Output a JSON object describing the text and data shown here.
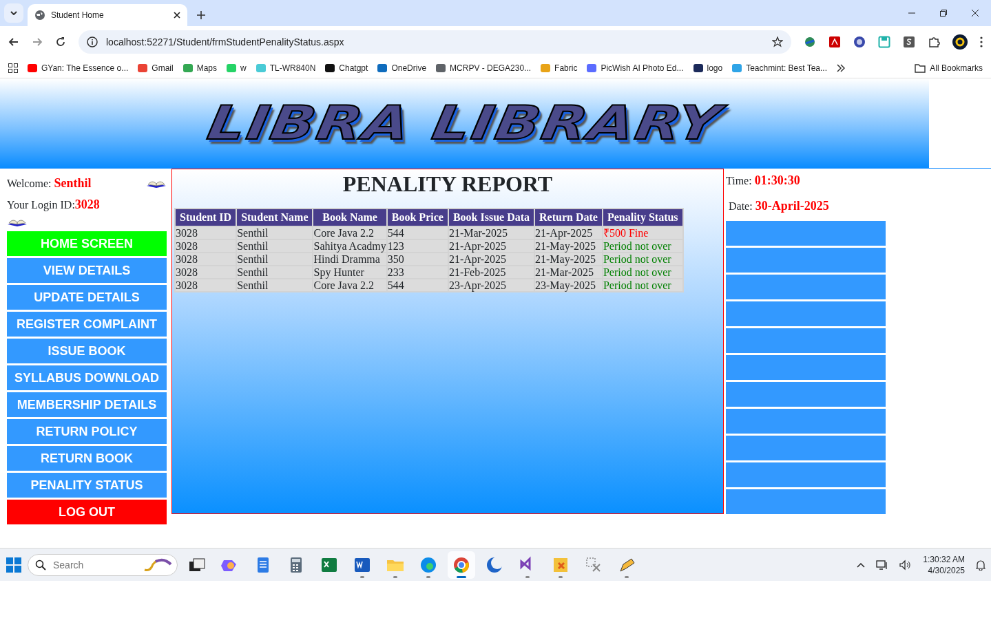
{
  "browser": {
    "tab_title": "Student Home",
    "url": "localhost:52271/Student/frmStudentPenalityStatus.aspx",
    "bookmarks": [
      {
        "label": "GYan: The Essence o...",
        "color": "#ff0000"
      },
      {
        "label": "Gmail",
        "color": "#ea4335"
      },
      {
        "label": "Maps",
        "color": "#34a853"
      },
      {
        "label": "w",
        "color": "#25d366"
      },
      {
        "label": "TL-WR840N",
        "color": "#4acbd6"
      },
      {
        "label": "Chatgpt",
        "color": "#111111"
      },
      {
        "label": "OneDrive",
        "color": "#0f6cbd"
      },
      {
        "label": "MCRPV - DEGA230...",
        "color": "#5f6368"
      },
      {
        "label": "Fabric",
        "color": "#e8a317"
      },
      {
        "label": "PicWish AI Photo Ed...",
        "color": "#5b6cff"
      },
      {
        "label": "logo",
        "color": "#1b2a5a"
      },
      {
        "label": "Teachmint: Best Tea...",
        "color": "#2fa4e7"
      }
    ],
    "all_bookmarks": "All Bookmarks"
  },
  "banner": {
    "logo_text": "LIBRA LIBRARY"
  },
  "user": {
    "welcome_label": "Welcome:",
    "name": "Senthil",
    "login_label": "Your Login ID:",
    "login_id": "3028"
  },
  "menu": [
    {
      "label": "HOME SCREEN",
      "color": "#00ff00"
    },
    {
      "label": "VIEW DETAILS",
      "color": "#3399ff"
    },
    {
      "label": "UPDATE DETAILS",
      "color": "#3399ff"
    },
    {
      "label": "REGISTER COMPLAINT",
      "color": "#3399ff"
    },
    {
      "label": "ISSUE BOOK",
      "color": "#3399ff"
    },
    {
      "label": "SYLLABUS DOWNLOAD",
      "color": "#3399ff"
    },
    {
      "label": "MEMBERSHIP DETAILS",
      "color": "#3399ff"
    },
    {
      "label": "RETURN POLICY",
      "color": "#3399ff"
    },
    {
      "label": "RETURN BOOK",
      "color": "#3399ff"
    },
    {
      "label": "PENALITY STATUS",
      "color": "#3399ff"
    },
    {
      "label": "LOG OUT",
      "color": "#ff0000"
    }
  ],
  "report": {
    "title": "PENALITY REPORT",
    "columns": [
      "Student ID",
      "Student Name",
      "Book Name",
      "Book Price",
      "Book Issue Data",
      "Return Date",
      "Penality Status"
    ],
    "rows": [
      {
        "cells": [
          "3028",
          "Senthil",
          "Core Java 2.2",
          "544",
          "21-Mar-2025",
          "21-Apr-2025",
          "₹500 Fine"
        ],
        "color": "#ff0000"
      },
      {
        "cells": [
          "3028",
          "Senthil",
          "Sahitya Acadmy",
          "123",
          "21-Apr-2025",
          "21-May-2025",
          "Period not over"
        ],
        "color": "#008000"
      },
      {
        "cells": [
          "3028",
          "Senthil",
          "Hindi Dramma",
          "350",
          "21-Apr-2025",
          "21-May-2025",
          "Period not over"
        ],
        "color": "#008000"
      },
      {
        "cells": [
          "3028",
          "Senthil",
          "Spy Hunter",
          "233",
          "21-Feb-2025",
          "21-Mar-2025",
          "Period not over"
        ],
        "color": "#008000"
      },
      {
        "cells": [
          "3028",
          "Senthil",
          "Core Java 2.2",
          "544",
          "23-Apr-2025",
          "23-May-2025",
          "Period not over"
        ],
        "color": "#008000"
      }
    ]
  },
  "clock": {
    "time_label": "Time:",
    "time": "01:30:30",
    "date_label": "Date:",
    "date": "30-April-2025"
  },
  "side_slots": [
    {
      "kind": "blank"
    },
    {
      "kind": "blank"
    },
    {
      "kind": "blank"
    },
    {
      "kind": "blank"
    },
    {
      "kind": "blank"
    },
    {
      "kind": "blank"
    },
    {
      "kind": "blank"
    },
    {
      "kind": "blank"
    },
    {
      "kind": "blank"
    },
    {
      "kind": "blank"
    },
    {
      "kind": "blank"
    }
  ],
  "taskbar": {
    "search_placeholder": "Search",
    "time": "1:30:32 AM",
    "date": "4/30/2025",
    "apps": [
      {
        "kind": "task-view",
        "running": false,
        "selected": false
      },
      {
        "kind": "copilot",
        "running": false,
        "selected": false
      },
      {
        "kind": "notepad",
        "running": false,
        "selected": false
      },
      {
        "kind": "calculator",
        "running": false,
        "selected": false
      },
      {
        "kind": "spreadsheet",
        "running": false,
        "selected": false
      },
      {
        "kind": "document",
        "running": true,
        "selected": false
      },
      {
        "kind": "folder",
        "running": true,
        "selected": false
      },
      {
        "kind": "edge",
        "running": true,
        "selected": false
      },
      {
        "kind": "chrome",
        "running": true,
        "selected": true
      },
      {
        "kind": "moon",
        "running": false,
        "selected": false
      },
      {
        "kind": "studio",
        "running": true,
        "selected": false
      },
      {
        "kind": "archive",
        "running": true,
        "selected": false
      },
      {
        "kind": "tools",
        "running": false,
        "selected": false
      },
      {
        "kind": "pencil",
        "running": true,
        "selected": false
      }
    ]
  }
}
